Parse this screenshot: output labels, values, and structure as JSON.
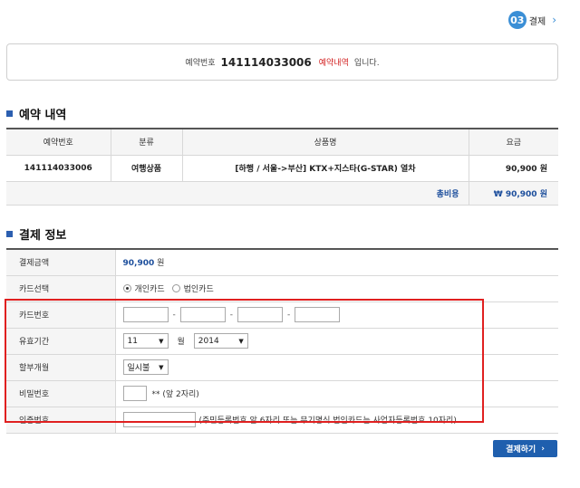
{
  "step": {
    "number": "03",
    "label": "결제",
    "arrow": "›"
  },
  "notice": {
    "label": "예약번호",
    "number": "141114033006",
    "link": "예약내역",
    "suffix": "입니다."
  },
  "reservation": {
    "title": "예약 내역",
    "headers": [
      "예약번호",
      "분류",
      "상품명",
      "요금"
    ],
    "row": [
      "141114033006",
      "여행상품",
      "[하행 / 서울->부산] KTX+지스타(G-STAR) 열차",
      "90,900 원"
    ],
    "total_label": "총비용",
    "total_value": "₩ 90,900 원"
  },
  "payment": {
    "title": "결제 정보",
    "amount_label": "결제금액",
    "amount_value": "90,900",
    "amount_unit": "원",
    "card_select_label": "카드선택",
    "card_personal": "개인카드",
    "card_corporate": "법인카드",
    "card_number_label": "카드번호",
    "expiry_label": "유효기간",
    "expiry_month": "11",
    "expiry_month_unit": "월",
    "expiry_year": "2014",
    "installment_label": "할부개월",
    "installment_value": "일시불",
    "password_label": "비밀번호",
    "password_hint": "** (앞 2자리)",
    "auth_label": "인증번호",
    "auth_hint": "(주민등록번호 앞 6자리 또는 무기명식 법인카드는 사업자등록번호 10자리)"
  },
  "pay_button": {
    "label": "결제하기",
    "arrow": "›"
  },
  "colors": {
    "accent": "#1f5fae",
    "highlight": "#e02020",
    "step": "#3b8fd6"
  }
}
